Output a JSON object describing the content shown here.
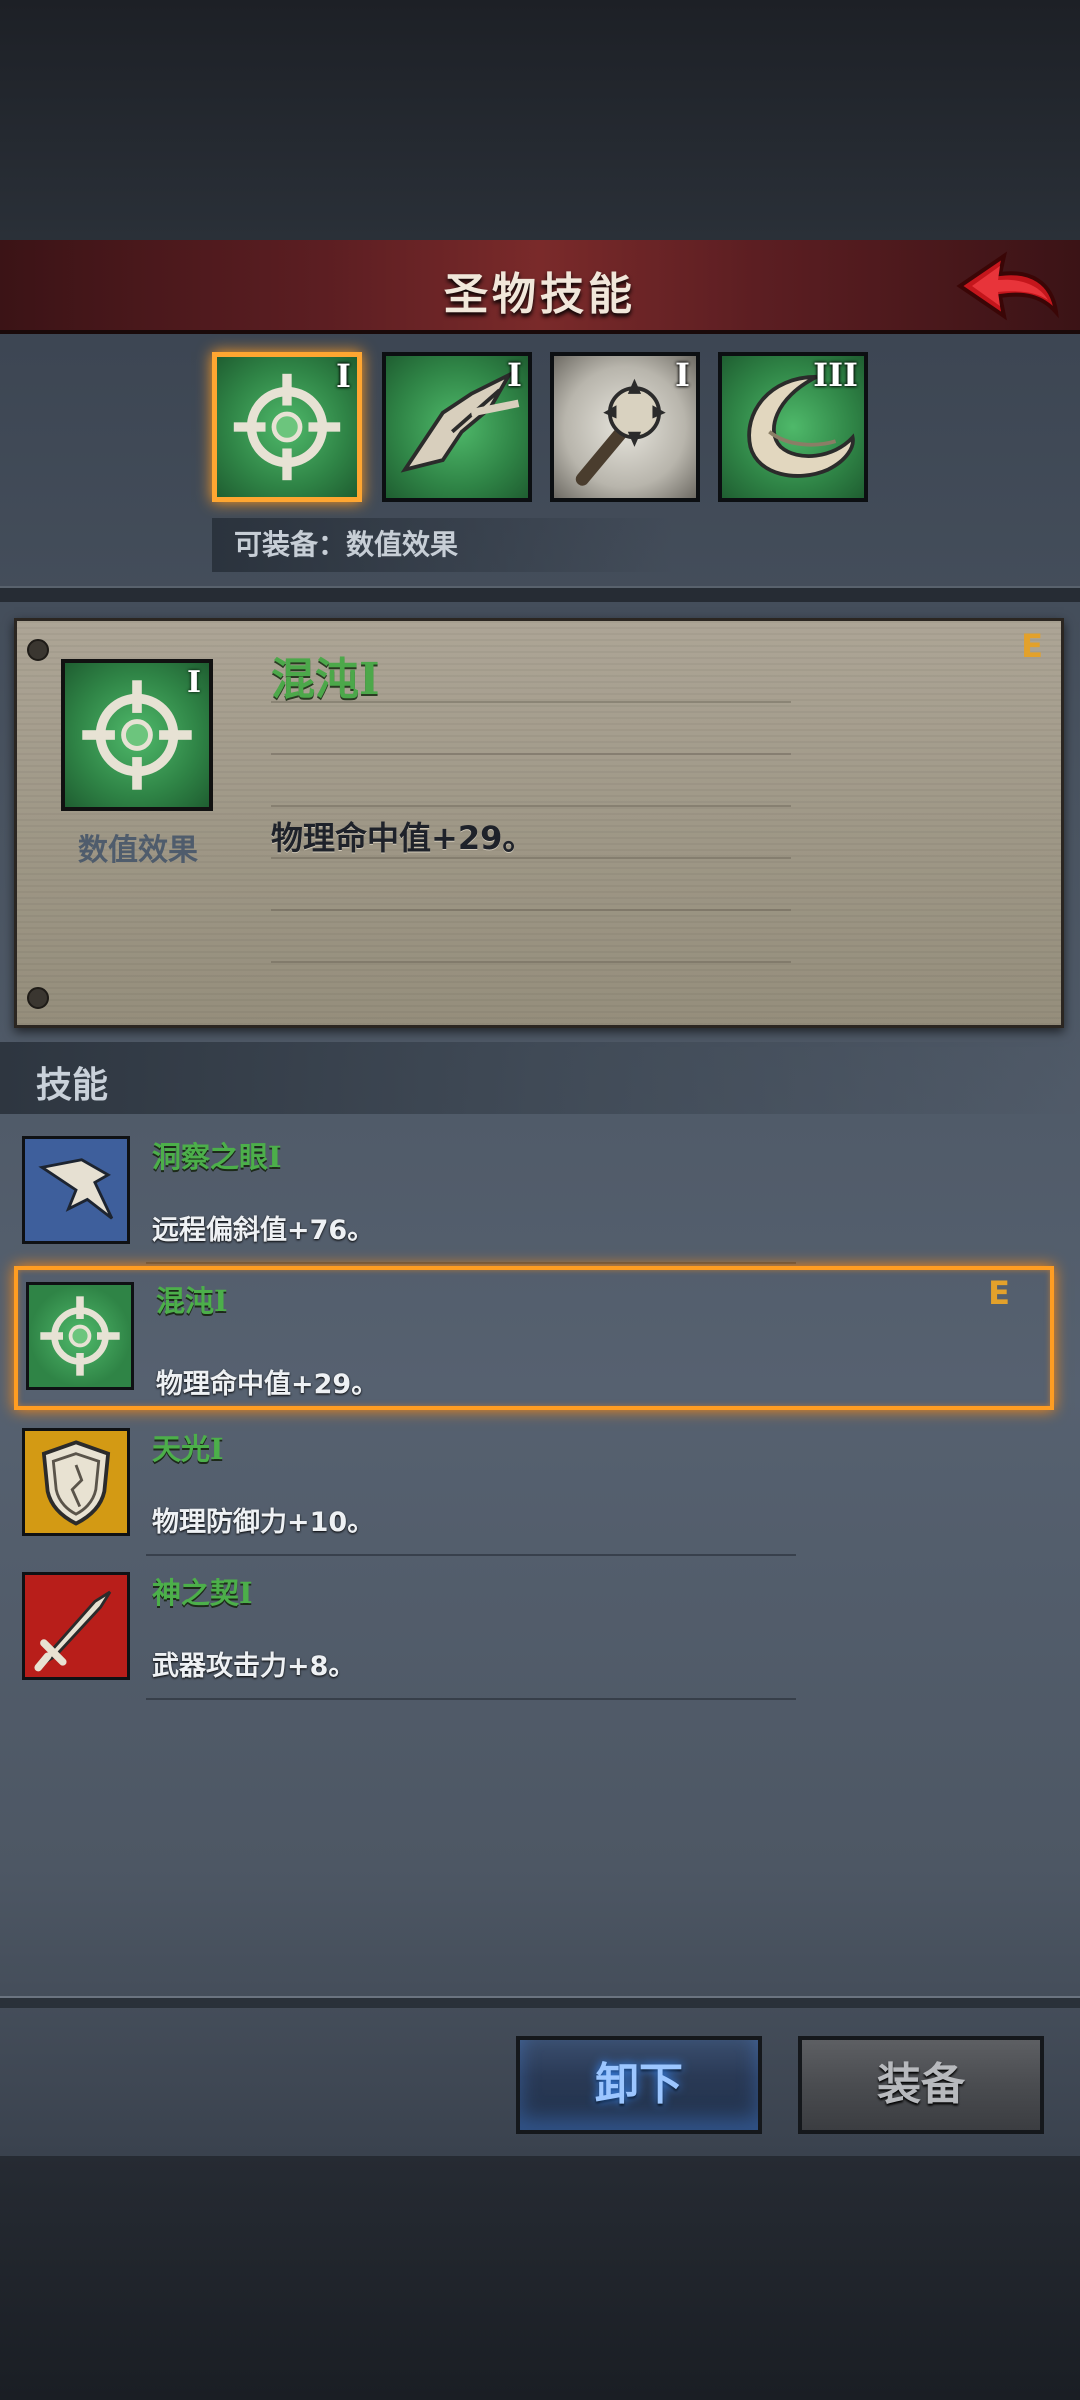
{
  "header": {
    "title": "圣物技能"
  },
  "relic_slots": [
    {
      "level": "I",
      "icon": "crosshair-icon",
      "selected": true
    },
    {
      "level": "I",
      "icon": "bird-feather-icon",
      "selected": false
    },
    {
      "level": "I",
      "icon": "spiked-mace-icon",
      "selected": false
    },
    {
      "level": "III",
      "icon": "horn-icon",
      "selected": false
    }
  ],
  "equip_hint": "可装备：数值效果",
  "detail": {
    "name": "混沌",
    "level": "I",
    "category": "数值效果",
    "equipped_mark": "E",
    "description": "物理命中值+29。"
  },
  "skills_section": {
    "title": "技能",
    "items": [
      {
        "name": "洞察之眼",
        "level": "I",
        "description": "远程偏斜值+76。",
        "icon": "hawk-icon",
        "icon_bg": "#3e5f9c",
        "equipped": false
      },
      {
        "name": "混沌",
        "level": "I",
        "description": "物理命中值+29。",
        "icon": "crosshair-icon",
        "icon_bg": "#2f8446",
        "equipped": true,
        "equipped_mark": "E"
      },
      {
        "name": "天光",
        "level": "I",
        "description": "物理防御力+10。",
        "icon": "shield-icon",
        "icon_bg": "#d39a14",
        "equipped": false
      },
      {
        "name": "神之契",
        "level": "I",
        "description": "武器攻击力+8。",
        "icon": "sword-icon",
        "icon_bg": "#b81e1a",
        "equipped": false
      }
    ]
  },
  "buttons": {
    "unequip": "卸下",
    "equip": "装备"
  },
  "colors": {
    "accent_orange": "#ff9d22",
    "skill_name_green": "#4caf4a",
    "header_red": "#7a2a2a"
  }
}
